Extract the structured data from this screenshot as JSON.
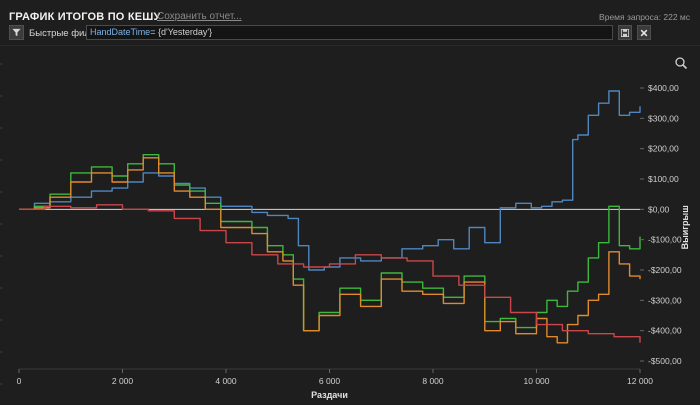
{
  "header": {
    "title": "ГРАФИК ИТОГОВ ПО КЕШУ",
    "save_link": "Сохранить отчет...",
    "request_time": "Время запроса: 222 мс"
  },
  "filter_bar": {
    "label": "Быстрые фильтры",
    "query_field": "HandDateTime",
    "query_op": "=",
    "query_value": "{d'Yesterday'}",
    "icons": [
      "filter-icon",
      "save-icon",
      "close-icon"
    ]
  },
  "toolbar": {
    "zoom_icon": "magnifier-icon"
  },
  "chart_data": {
    "type": "line",
    "xlabel": "Раздачи",
    "ylabel": "Выигрыш",
    "xlim": [
      0,
      12000
    ],
    "ylim": [
      -500,
      400
    ],
    "x_ticks": [
      0,
      2000,
      4000,
      6000,
      8000,
      10000,
      12000
    ],
    "x_tick_labels": [
      "0",
      "2 000",
      "4 000",
      "6 000",
      "8 000",
      "10 000",
      "12 000"
    ],
    "y_ticks": [
      400,
      300,
      200,
      100,
      0,
      -100,
      -200,
      -300,
      -400,
      -500
    ],
    "y_tick_labels": [
      "$400,00",
      "$300,00",
      "$200,00",
      "$100,00",
      "$0,00",
      "-$100,00",
      "-$200,00",
      "-$300,00",
      "-$400,00",
      "-$500,00"
    ],
    "zero_line": true,
    "series": [
      {
        "color": "#4f86c0",
        "x": [
          0,
          300,
          600,
          1000,
          1400,
          1800,
          2100,
          2400,
          2700,
          3000,
          3300,
          3600,
          3900,
          4200,
          4500,
          4800,
          5200,
          5400,
          5600,
          5900,
          6200,
          6600,
          7000,
          7400,
          7800,
          8100,
          8400,
          8700,
          9000,
          9300,
          9600,
          9900,
          10100,
          10300,
          10500,
          10700,
          10800,
          11000,
          11200,
          11400,
          11600,
          11800,
          12000
        ],
        "values": [
          0,
          20,
          25,
          40,
          60,
          70,
          90,
          120,
          110,
          85,
          70,
          40,
          10,
          10,
          -10,
          -20,
          -30,
          -120,
          -200,
          -190,
          -160,
          -170,
          -160,
          -130,
          -120,
          -100,
          -130,
          -60,
          -110,
          5,
          20,
          5,
          10,
          25,
          30,
          230,
          245,
          310,
          350,
          390,
          310,
          320,
          340
        ]
      },
      {
        "color": "#3db83d",
        "x": [
          0,
          300,
          600,
          1000,
          1400,
          1800,
          2100,
          2400,
          2700,
          3000,
          3300,
          3600,
          3900,
          4200,
          4500,
          4800,
          5100,
          5300,
          5500,
          5800,
          6200,
          6600,
          7000,
          7400,
          7800,
          8200,
          8600,
          9000,
          9300,
          9600,
          10000,
          10200,
          10400,
          10600,
          10800,
          11000,
          11200,
          11400,
          11600,
          11800,
          12000
        ],
        "values": [
          0,
          10,
          50,
          120,
          140,
          110,
          150,
          180,
          150,
          80,
          60,
          20,
          -40,
          -40,
          -60,
          -120,
          -150,
          -230,
          -400,
          -340,
          -260,
          -300,
          -210,
          -240,
          -260,
          -290,
          -220,
          -370,
          -360,
          -390,
          -340,
          -300,
          -320,
          -270,
          -240,
          -160,
          -110,
          10,
          -120,
          -130,
          -90
        ]
      },
      {
        "color": "#e08a2e",
        "x": [
          0,
          300,
          600,
          1000,
          1400,
          1800,
          2100,
          2400,
          2700,
          3000,
          3300,
          3600,
          3900,
          4200,
          4500,
          4800,
          5100,
          5300,
          5500,
          5800,
          6200,
          6600,
          7000,
          7400,
          7800,
          8200,
          8600,
          9000,
          9300,
          9600,
          10000,
          10200,
          10400,
          10600,
          10800,
          11000,
          11200,
          11400,
          11600,
          11800,
          12000
        ],
        "values": [
          0,
          5,
          40,
          90,
          120,
          90,
          130,
          170,
          120,
          60,
          40,
          0,
          -60,
          -60,
          -80,
          -140,
          -170,
          -250,
          -400,
          -350,
          -280,
          -320,
          -230,
          -270,
          -280,
          -310,
          -240,
          -400,
          -370,
          -410,
          -360,
          -420,
          -440,
          -380,
          -350,
          -300,
          -280,
          -140,
          -180,
          -220,
          -230
        ]
      },
      {
        "color": "#c9474b",
        "x": [
          0,
          500,
          1000,
          1500,
          2000,
          2500,
          3000,
          3500,
          4000,
          4500,
          5000,
          5500,
          6000,
          6500,
          7000,
          7500,
          8000,
          8500,
          9000,
          9500,
          10000,
          10500,
          11000,
          11500,
          12000
        ],
        "values": [
          0,
          10,
          5,
          15,
          0,
          -5,
          -30,
          -70,
          -110,
          -150,
          -180,
          -190,
          -180,
          -150,
          -160,
          -170,
          -220,
          -250,
          -290,
          -340,
          -380,
          -400,
          -410,
          -420,
          -440
        ]
      }
    ]
  }
}
